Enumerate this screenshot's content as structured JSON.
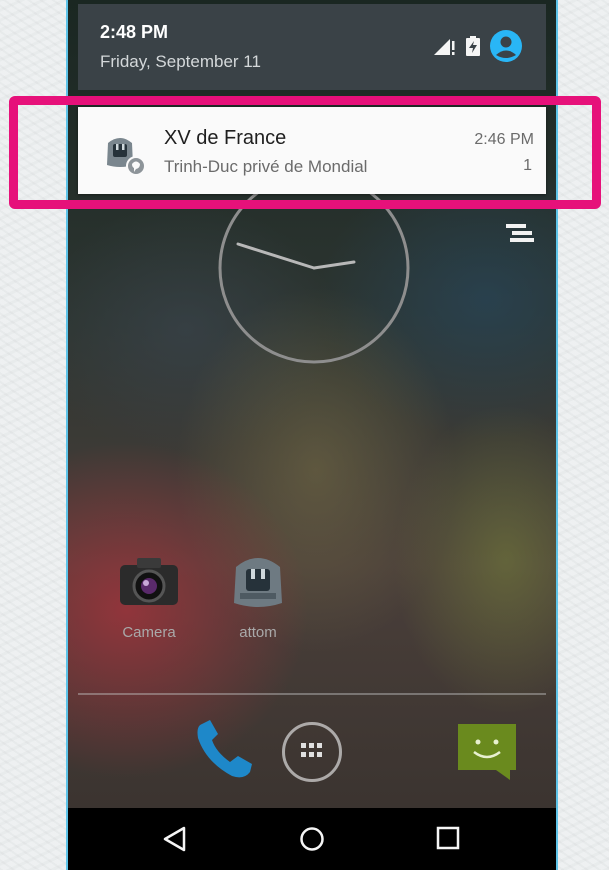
{
  "status_bar": {
    "time": "2:48 PM",
    "date": "Friday, September 11",
    "icons": [
      "signal-icon",
      "battery-icon",
      "account-icon"
    ]
  },
  "notification": {
    "app_icon": "attom-app-icon",
    "title": "XV de France",
    "text": "Trinh-Duc privé de Mondial",
    "time": "2:46 PM",
    "count": "1"
  },
  "home": {
    "apps": [
      {
        "label": "Camera",
        "icon": "camera-icon"
      },
      {
        "label": "attom",
        "icon": "attom-icon"
      }
    ],
    "dock": [
      "phone-icon",
      "app-drawer-icon",
      "messaging-icon"
    ]
  },
  "navigation": [
    "back-button",
    "home-button",
    "recents-button"
  ],
  "colors": {
    "highlight": "#e6117a",
    "accent": "#29b6f6",
    "shade_header": "#3a4247"
  }
}
